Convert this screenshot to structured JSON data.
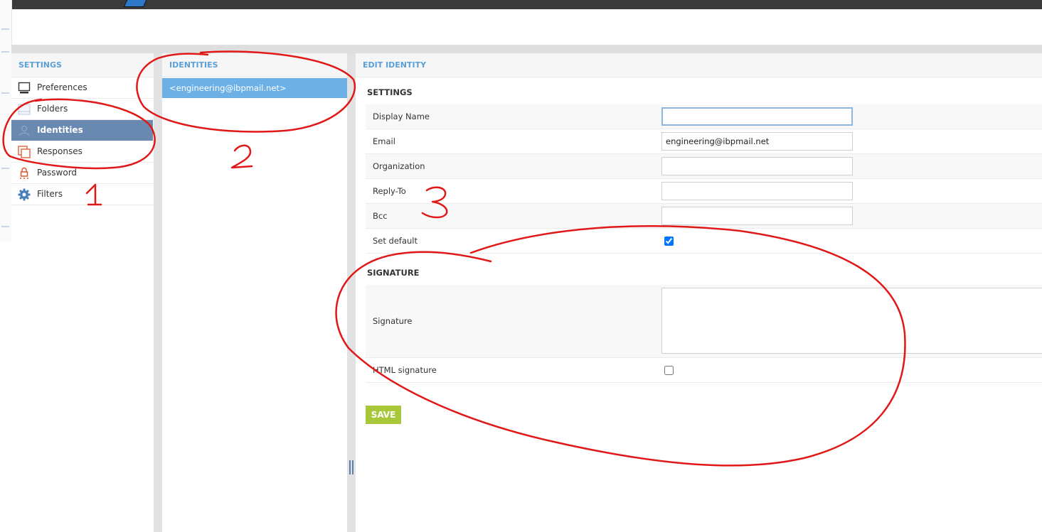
{
  "settings_panel": {
    "header": "SETTINGS",
    "items": [
      {
        "label": "Preferences",
        "icon": "monitor-icon"
      },
      {
        "label": "Folders",
        "icon": "folder-icon"
      },
      {
        "label": "Identities",
        "icon": "identity-icon",
        "active": true
      },
      {
        "label": "Responses",
        "icon": "responses-icon"
      },
      {
        "label": "Password",
        "icon": "lock-icon"
      },
      {
        "label": "Filters",
        "icon": "gear-icon"
      }
    ]
  },
  "identities_panel": {
    "header": "IDENTITIES",
    "items": [
      {
        "label": "<engineering@ibpmail.net>",
        "selected": true
      }
    ]
  },
  "edit_panel": {
    "header": "EDIT IDENTITY",
    "settings_title": "SETTINGS",
    "fields": {
      "display_name": {
        "label": "Display Name",
        "value": ""
      },
      "email": {
        "label": "Email",
        "value": "engineering@ibpmail.net"
      },
      "organization": {
        "label": "Organization",
        "value": ""
      },
      "reply_to": {
        "label": "Reply-To",
        "value": ""
      },
      "bcc": {
        "label": "Bcc",
        "value": ""
      },
      "set_default": {
        "label": "Set default",
        "checked": true
      }
    },
    "signature_title": "SIGNATURE",
    "signature": {
      "label": "Signature",
      "value": ""
    },
    "html_signature": {
      "label": "HTML signature",
      "checked": false
    },
    "save_label": "SAVE"
  },
  "annotations": {
    "color": "#e01818",
    "labels": [
      "1",
      "2",
      "3"
    ]
  },
  "colors": {
    "accent_header": "#5aa0d8",
    "active_nav": "#6a89b0",
    "selected_identity": "#6cb0e6",
    "save_button": "#a8c83a"
  }
}
